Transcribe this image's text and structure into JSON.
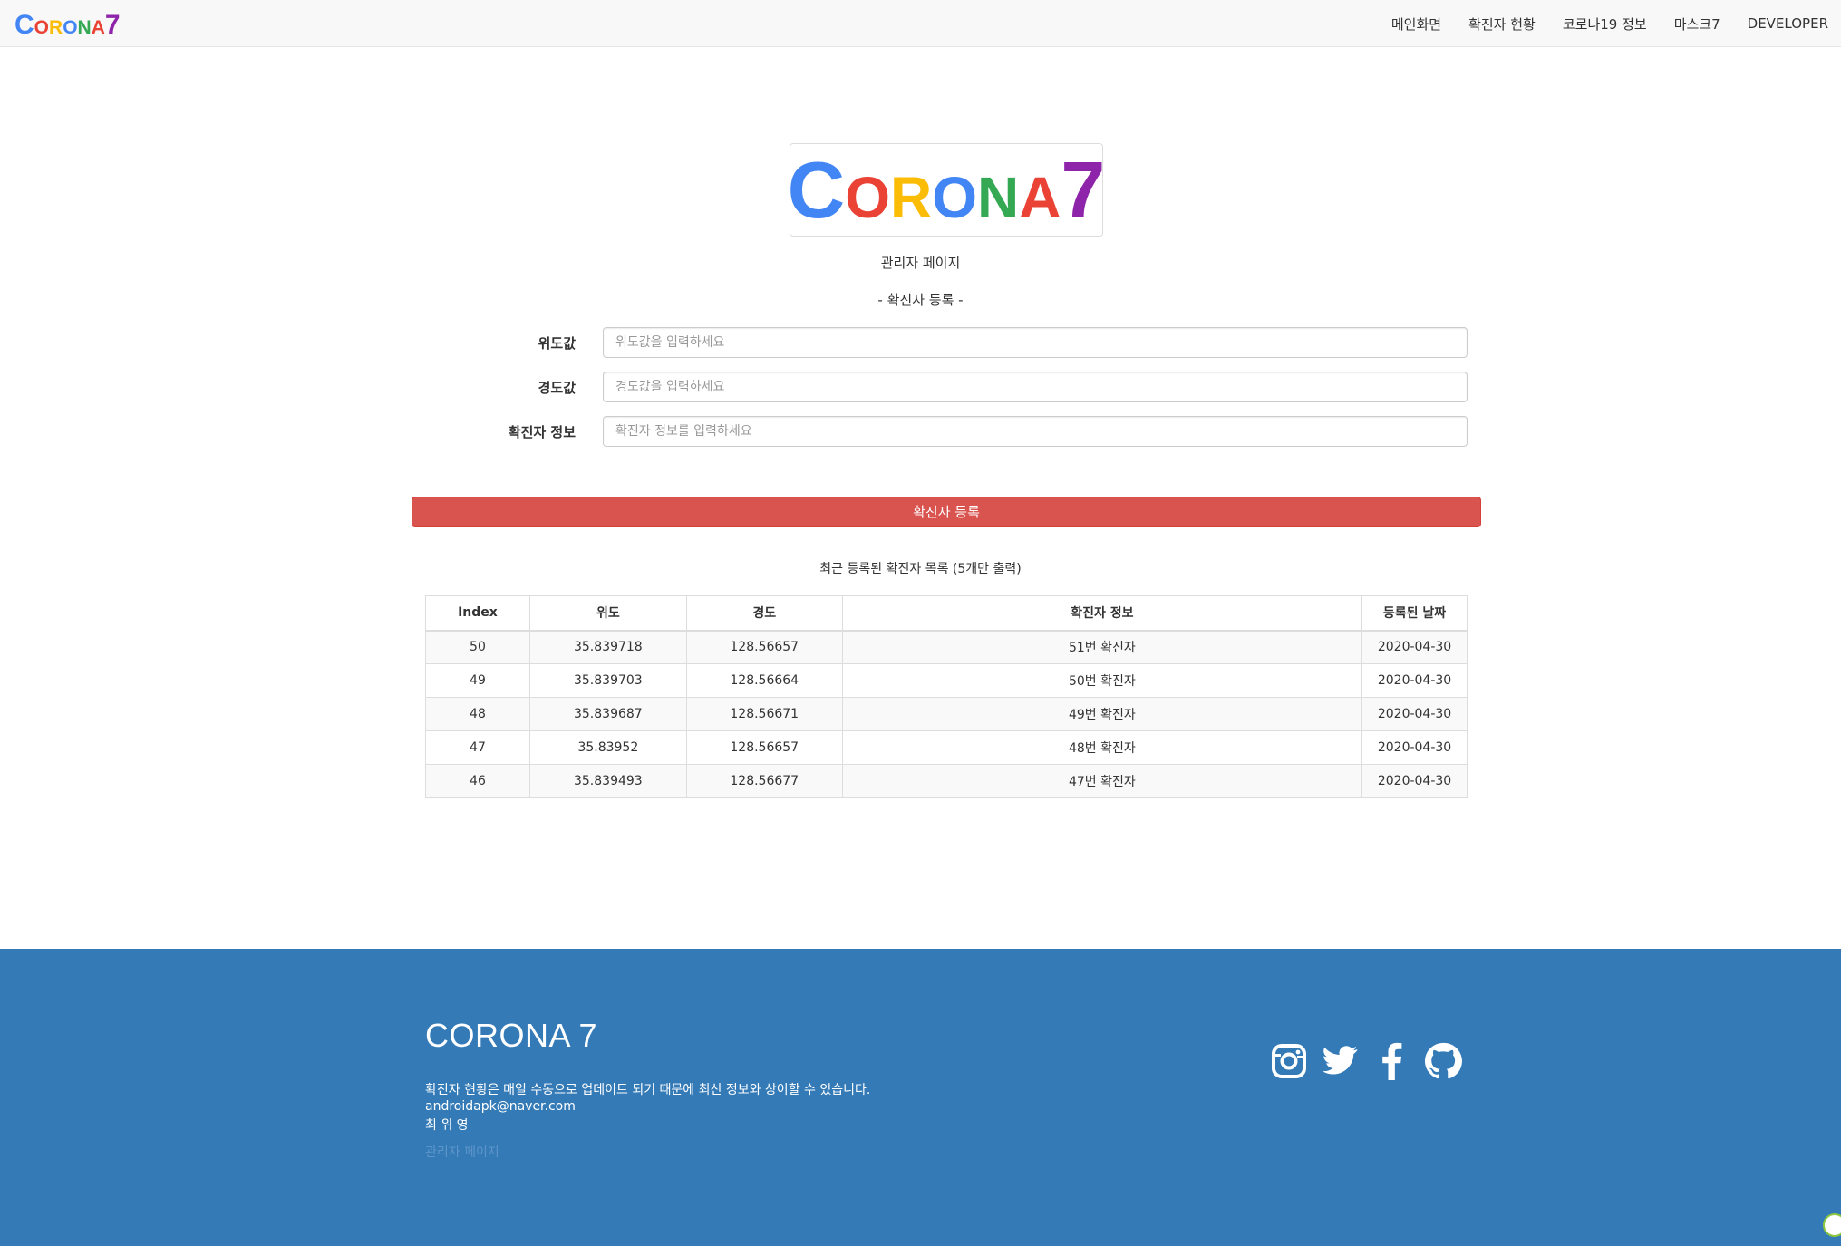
{
  "brand": {
    "first": "C",
    "rest": "ORONA",
    "last": "7"
  },
  "nav": {
    "items": [
      "메인화면",
      "확진자 현황",
      "코로나19 정보",
      "마스크7",
      "DEVELOPER"
    ]
  },
  "logo": {
    "letters": [
      "C",
      "O",
      "R",
      "O",
      "N",
      "A",
      "7"
    ],
    "colors": [
      "#4285f4",
      "#ea4335",
      "#fbbc05",
      "#4285f4",
      "#34a853",
      "#ea4335",
      "#8e24aa"
    ]
  },
  "page": {
    "admin_title": "관리자 페이지",
    "register_title": "- 확진자 등록 -"
  },
  "form": {
    "latitude_label": "위도값",
    "latitude_placeholder": "위도값을 입력하세요",
    "longitude_label": "경도값",
    "longitude_placeholder": "경도값을 입력하세요",
    "info_label": "확진자 정보",
    "info_placeholder": "확진자 정보를 입력하세요",
    "submit_label": "확진자 등록"
  },
  "recent": {
    "caption": "최근 등록된 확진자 목록 (5개만 출력)"
  },
  "table": {
    "headers": [
      "Index",
      "위도",
      "경도",
      "확진자 정보",
      "등록된 날짜"
    ],
    "rows": [
      [
        "50",
        "35.839718",
        "128.56657",
        "51번 확진자",
        "2020-04-30"
      ],
      [
        "49",
        "35.839703",
        "128.56664",
        "50번 확진자",
        "2020-04-30"
      ],
      [
        "48",
        "35.839687",
        "128.56671",
        "49번 확진자",
        "2020-04-30"
      ],
      [
        "47",
        "35.83952",
        "128.56657",
        "48번 확진자",
        "2020-04-30"
      ],
      [
        "46",
        "35.839493",
        "128.56677",
        "47번 확진자",
        "2020-04-30"
      ]
    ]
  },
  "footer": {
    "title": "CORONA 7",
    "notice": "확진자 현황은 매일 수동으로 업데이트 되기 때문에 최신 정보와 상이할 수 있습니다.",
    "email": "androidapk@naver.com",
    "author": "최 위 영",
    "admin_link": "관리자 페이지",
    "social_icons": [
      "instagram-icon",
      "twitter-icon",
      "facebook-icon",
      "github-icon"
    ]
  },
  "colors": {
    "navbar_bg": "#f8f8f8",
    "danger": "#d9534f",
    "footer_bg": "#337ab7"
  }
}
